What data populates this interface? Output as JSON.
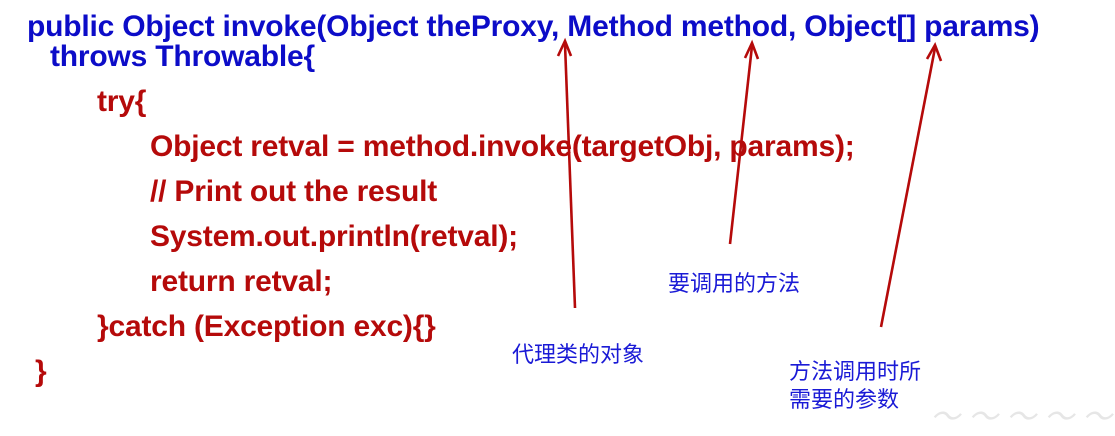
{
  "code": {
    "signature_line1": "public Object invoke(Object theProxy, Method method, Object[] params)",
    "signature_line2": "throws Throwable{",
    "body_lines": [
      "try{",
      "Object retval = method.invoke(targetObj, params);",
      "// Print out the result",
      "System.out.println(retval);",
      "return retval;",
      "}catch (Exception exc){}",
      "}"
    ]
  },
  "annotations": {
    "proxy_object": "代理类的对象",
    "method_to_call": "要调用的方法",
    "params_line1": "方法调用时所",
    "params_line2": "需要的参数"
  },
  "colors": {
    "signature": "#0c0cc8",
    "body": "#b50a0a",
    "annotation": "#1a1ad6",
    "arrow": "#b50a0a"
  }
}
